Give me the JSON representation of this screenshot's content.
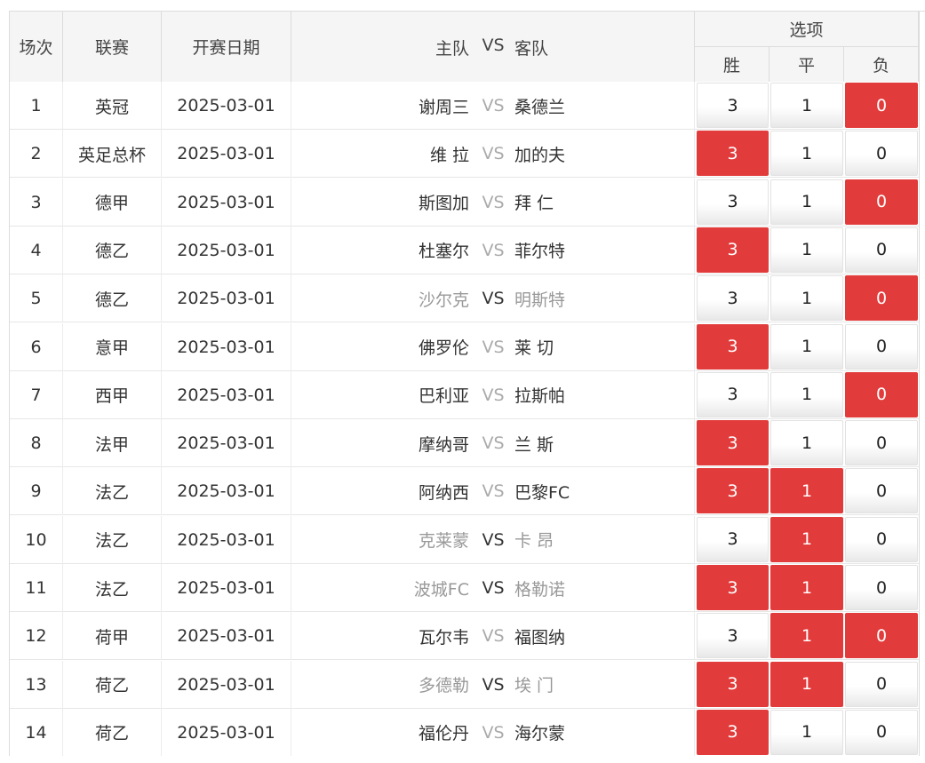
{
  "header": {
    "round": "场次",
    "league": "联赛",
    "date": "开赛日期",
    "match": {
      "home": "主队",
      "vs": "VS",
      "away": "客队"
    },
    "options": "选项",
    "win": "胜",
    "draw": "平",
    "lose": "负"
  },
  "rows": [
    {
      "no": "1",
      "league": "英冠",
      "date": "2025-03-01",
      "home": "谢周三",
      "vs": "VS",
      "away": "桑德兰",
      "w": "3",
      "d": "1",
      "l": "0",
      "sel": [
        "l"
      ],
      "faded": false
    },
    {
      "no": "2",
      "league": "英足总杯",
      "date": "2025-03-01",
      "home": "维 拉",
      "vs": "VS",
      "away": "加的夫",
      "w": "3",
      "d": "1",
      "l": "0",
      "sel": [
        "w"
      ],
      "faded": false
    },
    {
      "no": "3",
      "league": "德甲",
      "date": "2025-03-01",
      "home": "斯图加",
      "vs": "VS",
      "away": "拜 仁",
      "w": "3",
      "d": "1",
      "l": "0",
      "sel": [
        "l"
      ],
      "faded": false
    },
    {
      "no": "4",
      "league": "德乙",
      "date": "2025-03-01",
      "home": "杜塞尔",
      "vs": "VS",
      "away": "菲尔特",
      "w": "3",
      "d": "1",
      "l": "0",
      "sel": [
        "w"
      ],
      "faded": false
    },
    {
      "no": "5",
      "league": "德乙",
      "date": "2025-03-01",
      "home": "沙尔克",
      "vs": "VS",
      "away": "明斯特",
      "w": "3",
      "d": "1",
      "l": "0",
      "sel": [
        "l"
      ],
      "faded": true
    },
    {
      "no": "6",
      "league": "意甲",
      "date": "2025-03-01",
      "home": "佛罗伦",
      "vs": "VS",
      "away": "莱 切",
      "w": "3",
      "d": "1",
      "l": "0",
      "sel": [
        "w"
      ],
      "faded": false
    },
    {
      "no": "7",
      "league": "西甲",
      "date": "2025-03-01",
      "home": "巴利亚",
      "vs": "VS",
      "away": "拉斯帕",
      "w": "3",
      "d": "1",
      "l": "0",
      "sel": [
        "l"
      ],
      "faded": false
    },
    {
      "no": "8",
      "league": "法甲",
      "date": "2025-03-01",
      "home": "摩纳哥",
      "vs": "VS",
      "away": "兰 斯",
      "w": "3",
      "d": "1",
      "l": "0",
      "sel": [
        "w"
      ],
      "faded": false
    },
    {
      "no": "9",
      "league": "法乙",
      "date": "2025-03-01",
      "home": "阿纳西",
      "vs": "VS",
      "away": "巴黎FC",
      "w": "3",
      "d": "1",
      "l": "0",
      "sel": [
        "w",
        "d"
      ],
      "faded": false
    },
    {
      "no": "10",
      "league": "法乙",
      "date": "2025-03-01",
      "home": "克莱蒙",
      "vs": "VS",
      "away": "卡 昂",
      "w": "3",
      "d": "1",
      "l": "0",
      "sel": [
        "d"
      ],
      "faded": true
    },
    {
      "no": "11",
      "league": "法乙",
      "date": "2025-03-01",
      "home": "波城FC",
      "vs": "VS",
      "away": "格勒诺",
      "w": "3",
      "d": "1",
      "l": "0",
      "sel": [
        "w",
        "d"
      ],
      "faded": true
    },
    {
      "no": "12",
      "league": "荷甲",
      "date": "2025-03-01",
      "home": "瓦尔韦",
      "vs": "VS",
      "away": "福图纳",
      "w": "3",
      "d": "1",
      "l": "0",
      "sel": [
        "d",
        "l"
      ],
      "faded": false
    },
    {
      "no": "13",
      "league": "荷乙",
      "date": "2025-03-01",
      "home": "多德勒",
      "vs": "VS",
      "away": "埃 门",
      "w": "3",
      "d": "1",
      "l": "0",
      "sel": [
        "w",
        "d"
      ],
      "faded": true
    },
    {
      "no": "14",
      "league": "荷乙",
      "date": "2025-03-01",
      "home": "福伦丹",
      "vs": "VS",
      "away": "海尔蒙",
      "w": "3",
      "d": "1",
      "l": "0",
      "sel": [
        "w"
      ],
      "faded": false
    }
  ],
  "colors": {
    "selected": "#e23b3b",
    "header_bg": "#f5f5f5",
    "faded_text": "#999999"
  }
}
